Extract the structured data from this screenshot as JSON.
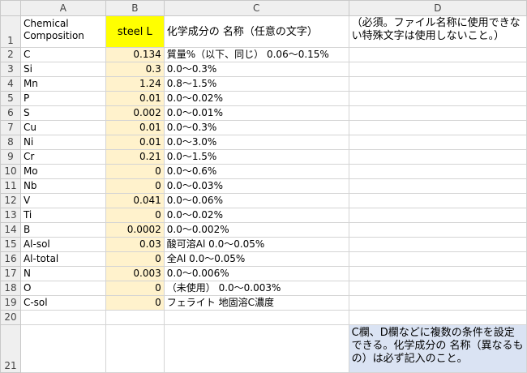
{
  "columns": [
    "A",
    "B",
    "C",
    "D"
  ],
  "header_row": {
    "row_num": "1",
    "a": "Chemical Composition",
    "b": "steel L",
    "c": "化学成分の 名称（任意の文字）",
    "d": "（必須。ファイル名称に使用できない特殊文字は使用しないこと。）"
  },
  "rows": [
    {
      "num": "2",
      "element": "C",
      "value": "0.134",
      "range": "質量%（以下、同じ） 0.06〜0.15%"
    },
    {
      "num": "3",
      "element": "Si",
      "value": "0.3",
      "range": "0.0〜0.3%"
    },
    {
      "num": "4",
      "element": "Mn",
      "value": "1.24",
      "range": "0.8〜1.5%"
    },
    {
      "num": "5",
      "element": "P",
      "value": "0.01",
      "range": "0.0〜0.02%"
    },
    {
      "num": "6",
      "element": "S",
      "value": "0.002",
      "range": "0.0〜0.01%"
    },
    {
      "num": "7",
      "element": "Cu",
      "value": "0.01",
      "range": "0.0〜0.3%"
    },
    {
      "num": "8",
      "element": "Ni",
      "value": "0.01",
      "range": "0.0〜3.0%"
    },
    {
      "num": "9",
      "element": "Cr",
      "value": "0.21",
      "range": "0.0〜1.5%"
    },
    {
      "num": "10",
      "element": "Mo",
      "value": "0",
      "range": "0.0〜0.6%"
    },
    {
      "num": "11",
      "element": "Nb",
      "value": "0",
      "range": "0.0〜0.03%"
    },
    {
      "num": "12",
      "element": "V",
      "value": "0.041",
      "range": "0.0〜0.06%"
    },
    {
      "num": "13",
      "element": "Ti",
      "value": "0",
      "range": "0.0〜0.02%"
    },
    {
      "num": "14",
      "element": "B",
      "value": "0.0002",
      "range": "0.0〜0.002%"
    },
    {
      "num": "15",
      "element": "Al-sol",
      "value": "0.03",
      "range": "酸可溶Al 0.0〜0.05%"
    },
    {
      "num": "16",
      "element": "Al-total",
      "value": "0",
      "range": "全Al 0.0〜0.05%"
    },
    {
      "num": "17",
      "element": "N",
      "value": "0.003",
      "range": " 0.0〜0.006%"
    },
    {
      "num": "18",
      "element": "O",
      "value": "0",
      "range": "（未使用） 0.0〜0.003%"
    },
    {
      "num": "19",
      "element": "C-sol",
      "value": "0",
      "range": "フェライト 地固溶C濃度"
    }
  ],
  "row20": {
    "num": "20"
  },
  "row21": {
    "num": "21",
    "d": "C欄、D欄などに複数の条件を設定できる。化学成分の 名称（異なるもの）は必ず記入のこと。"
  },
  "colors": {
    "highlight_yellow": "#ffff00",
    "value_fill": "#fff2cc",
    "note_fill": "#dae3f3"
  }
}
